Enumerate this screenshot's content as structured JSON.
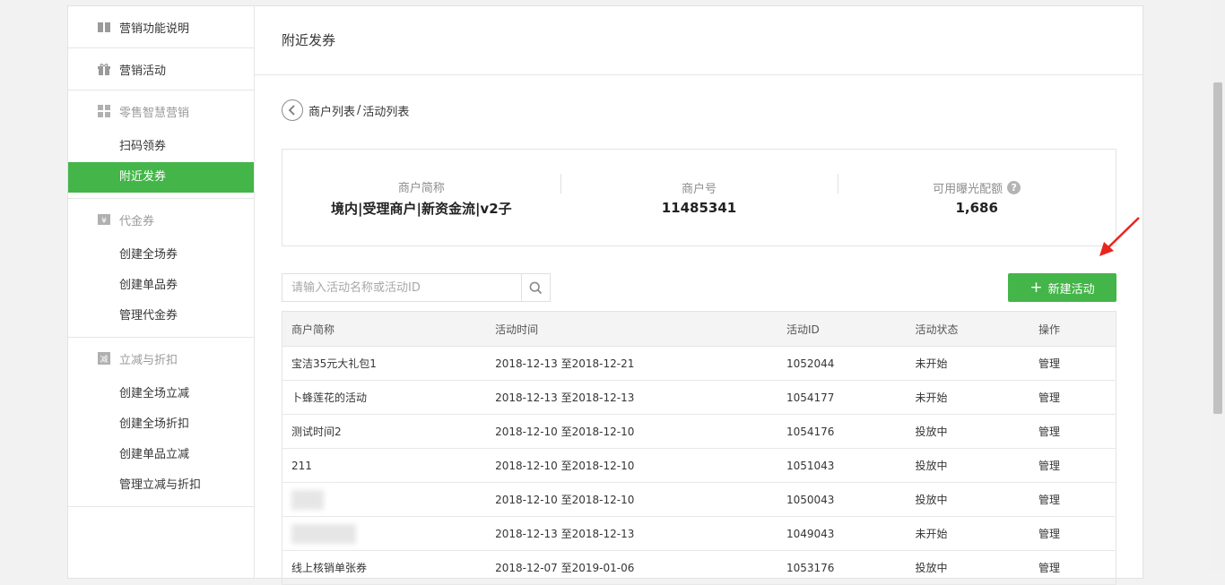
{
  "sidebar": {
    "groups": [
      {
        "title": "营销功能说明",
        "icon": "book-icon",
        "muted": false,
        "items": []
      },
      {
        "title": "营销活动",
        "icon": "gift-icon",
        "muted": false,
        "items": []
      },
      {
        "title": "零售智慧营销",
        "icon": "grid-icon",
        "muted": true,
        "items": [
          {
            "label": "扫码领券",
            "active": false
          },
          {
            "label": "附近发券",
            "active": true
          }
        ]
      },
      {
        "title": "代金券",
        "icon": "yen-ticket-icon",
        "muted": true,
        "items": [
          {
            "label": "创建全场券",
            "active": false
          },
          {
            "label": "创建单品券",
            "active": false
          },
          {
            "label": "管理代金券",
            "active": false
          }
        ]
      },
      {
        "title": "立减与折扣",
        "icon": "discount-icon",
        "muted": true,
        "items": [
          {
            "label": "创建全场立减",
            "active": false
          },
          {
            "label": "创建全场折扣",
            "active": false
          },
          {
            "label": "创建单品立减",
            "active": false
          },
          {
            "label": "管理立减与折扣",
            "active": false
          }
        ]
      }
    ]
  },
  "main": {
    "title": "附近发券",
    "breadcrumb": {
      "first": "商户列表",
      "separator": "/",
      "current": "活动列表"
    },
    "info": {
      "name_label": "商户简称",
      "name_value": "境内|受理商户|新资金流|v2子",
      "id_label": "商户号",
      "id_value": "11485341",
      "quota_label": "可用曝光配额",
      "quota_value": "1,686",
      "quota_help": "?"
    },
    "search": {
      "placeholder": "请输入活动名称或活动ID",
      "value": ""
    },
    "new_button": "新建活动",
    "table": {
      "headers": [
        "商户简称",
        "活动时间",
        "活动ID",
        "活动状态",
        "操作"
      ],
      "rows": [
        {
          "name": "宝洁35元大礼包1",
          "time": "2018-12-13 至2018-12-21",
          "id": "1052044",
          "status": "未开始",
          "live": false,
          "action": "管理"
        },
        {
          "name": "卜蜂莲花的活动",
          "time": "2018-12-13 至2018-12-13",
          "id": "1054177",
          "status": "未开始",
          "live": false,
          "action": "管理"
        },
        {
          "name": "测试时间2",
          "time": "2018-12-10 至2018-12-10",
          "id": "1054176",
          "status": "投放中",
          "live": true,
          "action": "管理"
        },
        {
          "name": "211",
          "time": "2018-12-10 至2018-12-10",
          "id": "1051043",
          "status": "投放中",
          "live": true,
          "action": "管理"
        },
        {
          "name": "",
          "blur_width": 36,
          "time": "2018-12-10 至2018-12-10",
          "id": "1050043",
          "status": "投放中",
          "live": true,
          "action": "管理"
        },
        {
          "name": "",
          "blur_width": 72,
          "time": "2018-12-13 至2018-12-13",
          "id": "1049043",
          "status": "未开始",
          "live": false,
          "action": "管理"
        },
        {
          "name": "线上核销单张券",
          "time": "2018-12-07 至2019-01-06",
          "id": "1053176",
          "status": "投放中",
          "live": true,
          "action": "管理"
        }
      ]
    }
  },
  "colors": {
    "accent": "#44b549",
    "link": "#576b95",
    "arrow": "#e8261e"
  }
}
